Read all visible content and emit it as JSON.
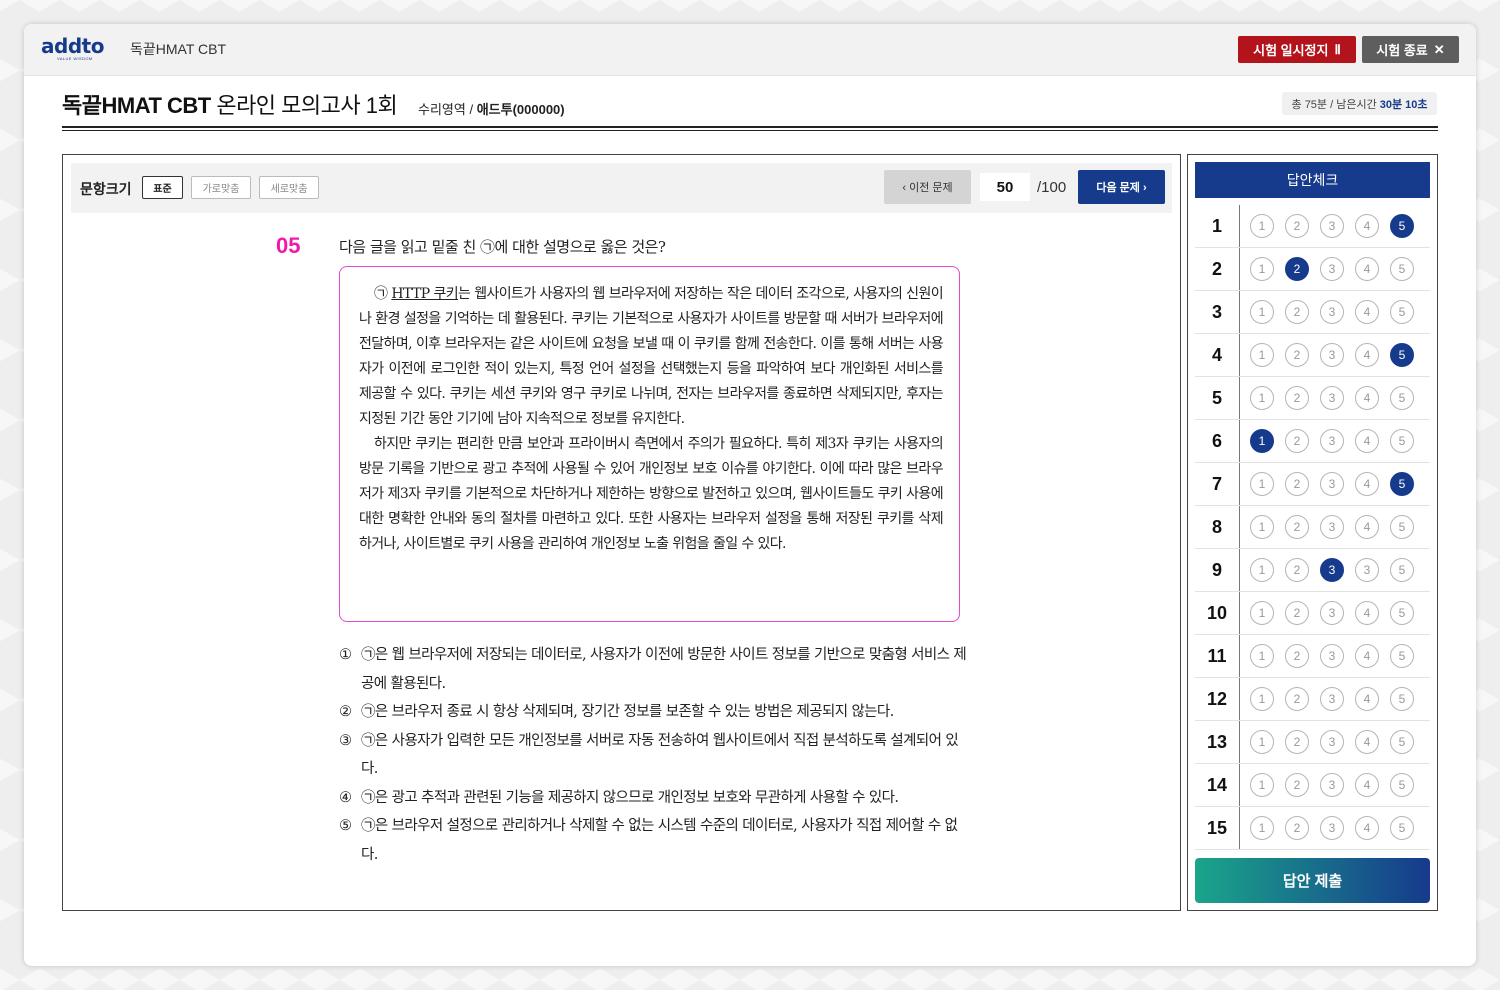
{
  "app": {
    "logo": "addto",
    "logo_tagline": "VALUE WISDOM",
    "title": "독끝HMAT CBT"
  },
  "header_buttons": {
    "pause_label": "시험 일시정지",
    "pause_icon": "Ⅱ",
    "end_label": "시험 종료",
    "end_icon": "✕"
  },
  "exam": {
    "title_bold": "독끝HMAT CBT",
    "title_rest": " 온라인 모의고사 1회",
    "section": "수리영역 / ",
    "user": "애드투(000000)",
    "timer_total": "총 75분 / 남은시간",
    "timer_remaining": "30분 10초"
  },
  "toolbar": {
    "size_label": "문항크기",
    "size_options": [
      "표준",
      "가로맞춤",
      "세로맞춤"
    ],
    "size_selected": "표준",
    "prev_label": "이전 문제",
    "current_page": "50",
    "total_pages": "/100",
    "next_label": "다음 문제"
  },
  "question": {
    "number": "05",
    "prompt": "다음 글을 읽고 밑줄 친 ㉠에 대한 설명으로 옳은 것은?",
    "passage": {
      "p1_marker": "㉠ ",
      "p1_underline": "HTTP 쿠키",
      "p1_text": "는 웹사이트가 사용자의 웹 브라우저에 저장하는 작은 데이터 조각으로, 사용자의 신원이나 환경 설정을 기억하는 데 활용된다. 쿠키는 기본적으로 사용자가 사이트를 방문할 때 서버가 브라우저에 전달하며, 이후 브라우저는 같은 사이트에 요청을 보낼 때 이 쿠키를 함께 전송한다. 이를 통해 서버는 사용자가 이전에 로그인한 적이 있는지, 특정 언어 설정을 선택했는지 등을 파악하여 보다 개인화된 서비스를 제공할 수 있다. 쿠키는 세션 쿠키와 영구 쿠키로 나뉘며, 전자는 브라우저를 종료하면 삭제되지만, 후자는 지정된 기간 동안 기기에 남아 지속적으로 정보를 유지한다.",
      "p2_text": "하지만 쿠키는 편리한 만큼 보안과 프라이버시 측면에서 주의가 필요하다. 특히 제3자 쿠키는 사용자의 방문 기록을 기반으로 광고 추적에 사용될 수 있어 개인정보 보호 이슈를 야기한다. 이에 따라 많은 브라우저가 제3자 쿠키를 기본적으로 차단하거나 제한하는 방향으로 발전하고 있으며, 웹사이트들도 쿠키 사용에 대한 명확한 안내와 동의 절차를 마련하고 있다. 또한 사용자는 브라우저 설정을 통해 저장된 쿠키를 삭제하거나, 사이트별로 쿠키 사용을 관리하여 개인정보 노출 위험을 줄일 수 있다."
    },
    "choices": [
      {
        "marker": "①",
        "text": "㉠은 웹 브라우저에 저장되는 데이터로, 사용자가 이전에 방문한 사이트 정보를 기반으로 맞춤형 서비스 제공에 활용된다."
      },
      {
        "marker": "②",
        "text": "㉠은 브라우저 종료 시 항상 삭제되며, 장기간 정보를 보존할 수 있는 방법은 제공되지 않는다."
      },
      {
        "marker": "③",
        "text": "㉠은 사용자가 입력한 모든 개인정보를 서버로 자동 전송하여 웹사이트에서 직접 분석하도록 설계되어 있다."
      },
      {
        "marker": "④",
        "text": "㉠은 광고 추적과 관련된 기능을 제공하지 않으므로 개인정보 보호와 무관하게 사용할 수 있다."
      },
      {
        "marker": "⑤",
        "text": "㉠은 브라우저 설정으로 관리하거나 삭제할 수 없는 시스템 수준의 데이터로, 사용자가 직접 제어할 수 없다."
      }
    ]
  },
  "answer_sheet": {
    "title": "답안체크",
    "submit_label": "답안 제출",
    "rows": [
      {
        "num": "1",
        "options": [
          "1",
          "2",
          "3",
          "4",
          "5"
        ],
        "selected": "5"
      },
      {
        "num": "2",
        "options": [
          "1",
          "2",
          "3",
          "4",
          "5"
        ],
        "selected": "2"
      },
      {
        "num": "3",
        "options": [
          "1",
          "2",
          "3",
          "4",
          "5"
        ],
        "selected": ""
      },
      {
        "num": "4",
        "options": [
          "1",
          "2",
          "3",
          "4",
          "5"
        ],
        "selected": "5"
      },
      {
        "num": "5",
        "options": [
          "1",
          "2",
          "3",
          "4",
          "5"
        ],
        "selected": ""
      },
      {
        "num": "6",
        "options": [
          "1",
          "2",
          "3",
          "4",
          "5"
        ],
        "selected": "1"
      },
      {
        "num": "7",
        "options": [
          "1",
          "2",
          "3",
          "4",
          "5"
        ],
        "selected": "5"
      },
      {
        "num": "8",
        "options": [
          "1",
          "2",
          "3",
          "4",
          "5"
        ],
        "selected": ""
      },
      {
        "num": "9",
        "options": [
          "1",
          "2",
          "3",
          "3",
          "5"
        ],
        "selected": "3"
      },
      {
        "num": "10",
        "options": [
          "1",
          "2",
          "3",
          "4",
          "5"
        ],
        "selected": ""
      },
      {
        "num": "11",
        "options": [
          "1",
          "2",
          "3",
          "4",
          "5"
        ],
        "selected": ""
      },
      {
        "num": "12",
        "options": [
          "1",
          "2",
          "3",
          "4",
          "5"
        ],
        "selected": ""
      },
      {
        "num": "13",
        "options": [
          "1",
          "2",
          "3",
          "4",
          "5"
        ],
        "selected": ""
      },
      {
        "num": "14",
        "options": [
          "1",
          "2",
          "3",
          "4",
          "5"
        ],
        "selected": ""
      },
      {
        "num": "15",
        "options": [
          "1",
          "2",
          "3",
          "4",
          "5"
        ],
        "selected": ""
      }
    ]
  },
  "colors": {
    "navy": "#163a8c",
    "pause_red": "#b3141c",
    "question_number": "#f01aa8",
    "passage_border": "#e44ad0"
  },
  "icons": {
    "prev": "chevron-left-icon",
    "next": "chevron-right-icon",
    "pause": "pause-icon",
    "close": "close-icon"
  }
}
